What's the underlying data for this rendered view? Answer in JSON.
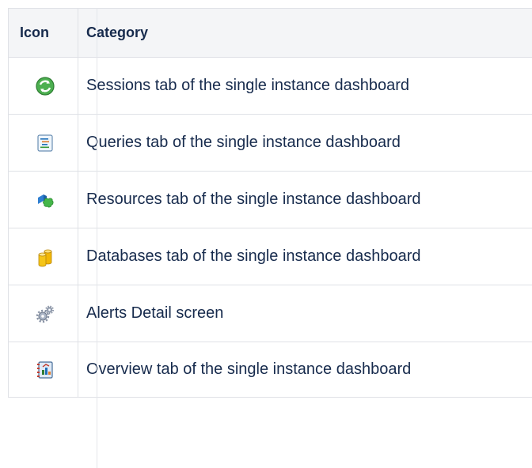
{
  "table": {
    "headers": {
      "icon": "Icon",
      "category": "Category"
    },
    "rows": [
      {
        "icon": "sessions-icon",
        "category": "Sessions tab of the single instance dashboard"
      },
      {
        "icon": "queries-icon",
        "category": "Queries tab of the single instance dashboard"
      },
      {
        "icon": "resources-icon",
        "category": "Resources tab of the single instance dashboard"
      },
      {
        "icon": "databases-icon",
        "category": "Databases tab of the single instance dashboard"
      },
      {
        "icon": "alerts-gears-icon",
        "category": "Alerts Detail screen"
      },
      {
        "icon": "overview-icon",
        "category": "Overview tab of the single instance dashboard"
      }
    ]
  },
  "colors": {
    "header_bg": "#f4f5f7",
    "border": "#dfe1e6",
    "text": "#172b4d"
  }
}
